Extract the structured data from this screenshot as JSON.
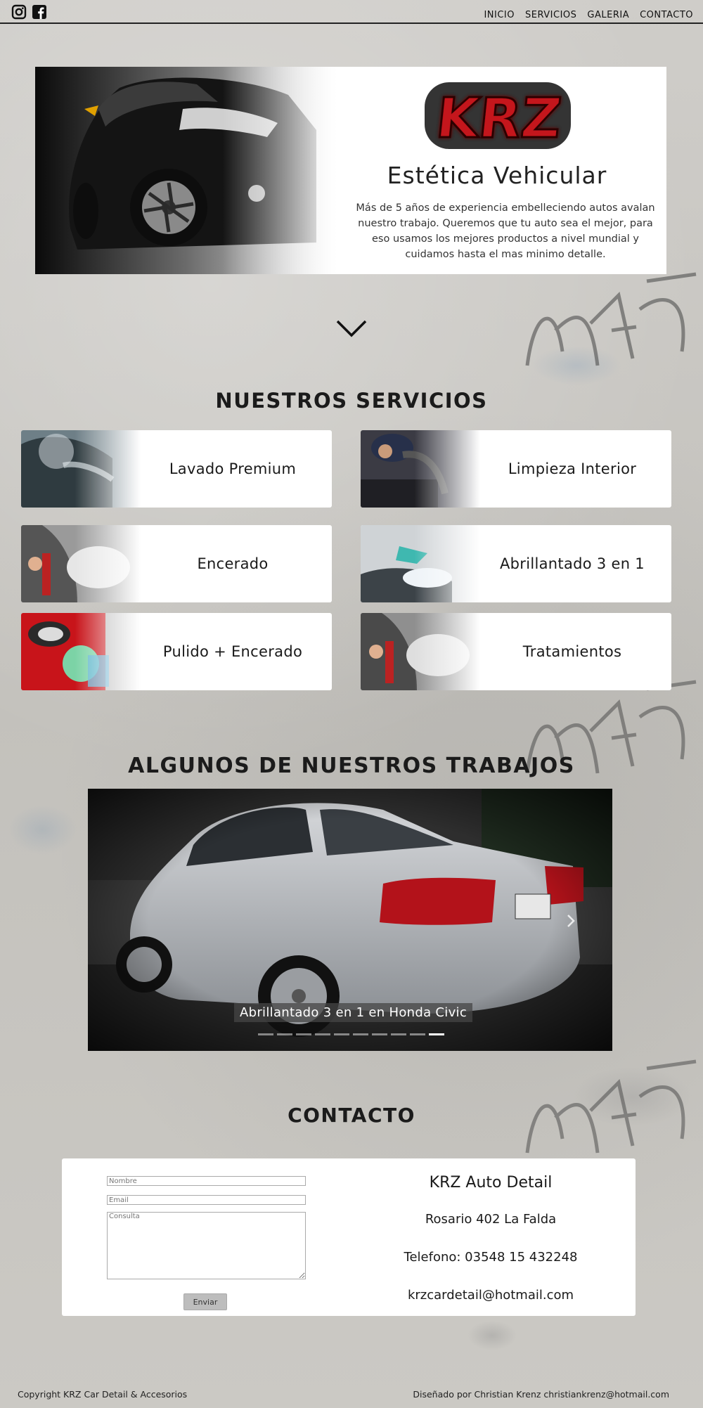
{
  "header": {
    "social": [
      "instagram-icon",
      "facebook-icon"
    ],
    "nav": [
      "INICIO",
      "SERVICIOS",
      "GALERIA",
      "CONTACTO"
    ]
  },
  "hero": {
    "logo_text": "KRZ",
    "title": "Estética Vehicular",
    "description": "Más de 5 años de experiencia embelleciendo autos avalan nuestro trabajo. Queremos que tu auto sea el mejor, para eso usamos los mejores productos a nivel mundial y cuidamos hasta el mas minimo detalle."
  },
  "services": {
    "title": "NUESTROS SERVICIOS",
    "items": [
      {
        "label": "Lavado Premium"
      },
      {
        "label": "Limpieza Interior"
      },
      {
        "label": "Encerado"
      },
      {
        "label": "Abrillantado 3 en 1"
      },
      {
        "label": "Pulido + Encerado"
      },
      {
        "label": "Tratamientos"
      }
    ]
  },
  "works": {
    "title": "ALGUNOS DE NUESTROS TRABAJOS",
    "caption": "Abrillantado 3 en 1 en Honda Civic",
    "slide_count": 10,
    "active_slide": 10
  },
  "contact": {
    "title": "CONTACTO",
    "form": {
      "name_placeholder": "Nombre",
      "email_placeholder": "Email",
      "message_placeholder": "Consulta",
      "submit": "Enviar"
    },
    "business": "KRZ Auto Detail",
    "address": "Rosario 402 La Falda",
    "phone": "Telefono: 03548 15 432248",
    "email": "krzcardetail@hotmail.com"
  },
  "footer": {
    "copyright": "Copyright KRZ Car Detail & Accesorios",
    "credit": "Diseñado por Christian Krenz christiankrenz@hotmail.com"
  },
  "colors": {
    "logo_red": "#c4161c",
    "card_bg": "#ffffff",
    "text_dark": "#1a1a1a"
  }
}
